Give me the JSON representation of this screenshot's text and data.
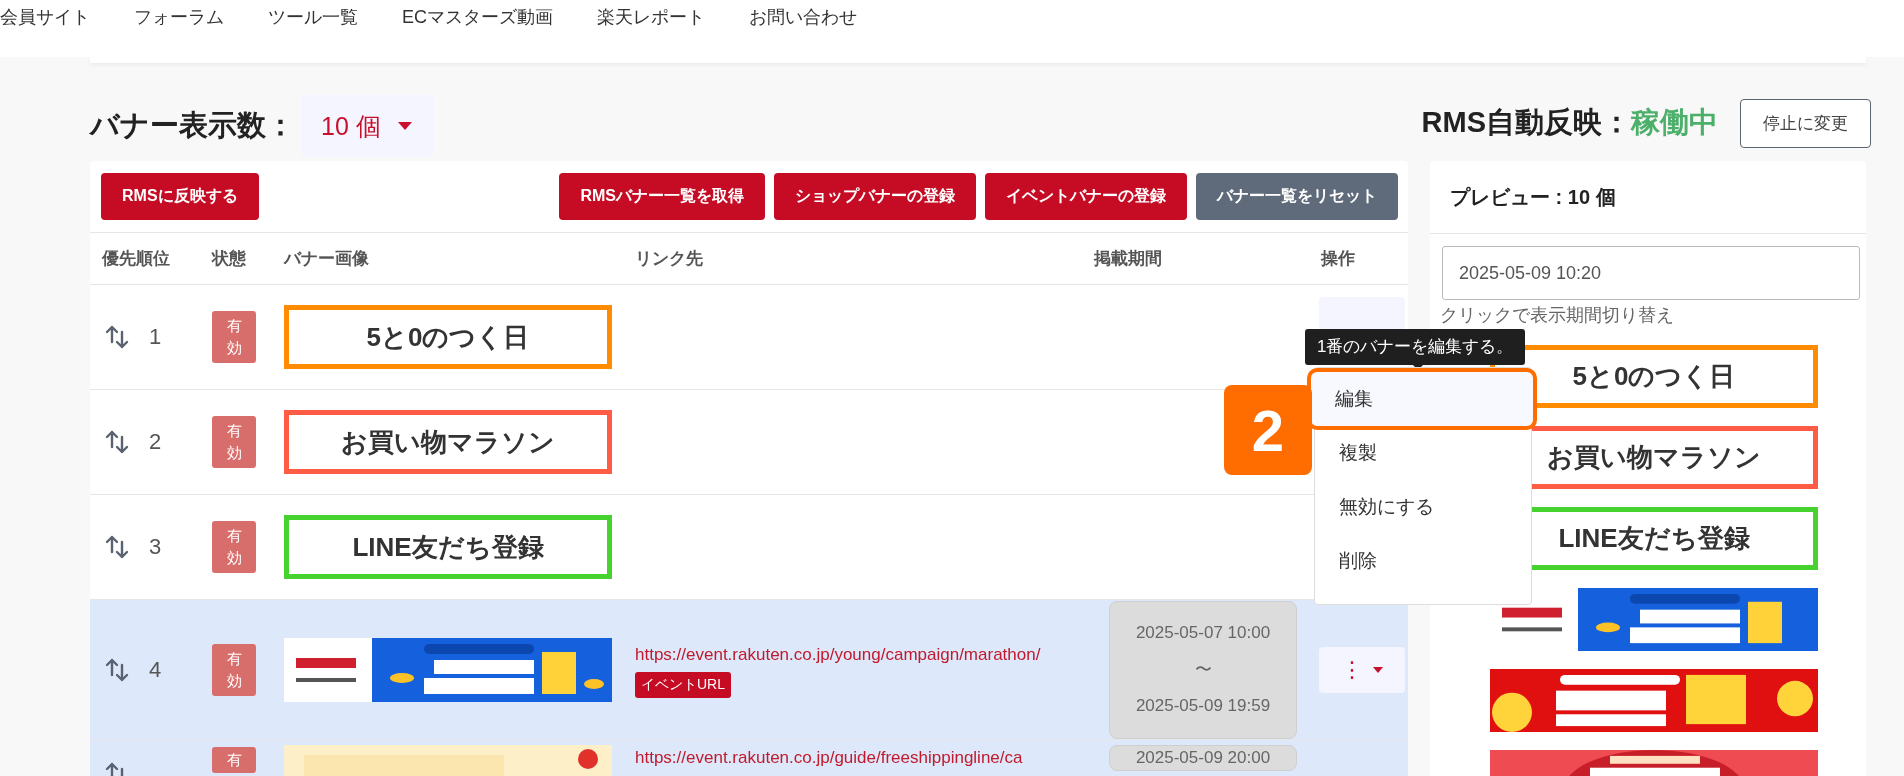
{
  "nav": {
    "items": [
      "会員サイト",
      "フォーラム",
      "ツール一覧",
      "ECマスターズ動画",
      "楽天レポート",
      "お問い合わせ"
    ]
  },
  "banner_count": {
    "label": "バナー表示数：",
    "value": "10 個"
  },
  "auto_sync": {
    "label": "RMS自動反映：",
    "status": "稼働中",
    "button": "停止に変更"
  },
  "toolbar": {
    "left": [
      "RMSに反映する"
    ],
    "right": [
      {
        "label": "RMSバナー一覧を取得",
        "kind": "primary"
      },
      {
        "label": "ショップバナーの登録",
        "kind": "primary"
      },
      {
        "label": "イベントバナーの登録",
        "kind": "primary"
      },
      {
        "label": "バナー一覧をリセット",
        "kind": "secondary"
      }
    ]
  },
  "table": {
    "columns": [
      "優先順位",
      "状態",
      "バナー画像",
      "リンク先",
      "掲載期間",
      "操作"
    ],
    "rows": [
      {
        "priority": "1",
        "state": "有効",
        "banner": {
          "kind": "text",
          "label": "5と0のつく日",
          "color": "#ff8c00"
        },
        "highlighted": false,
        "menu_open": true
      },
      {
        "priority": "2",
        "state": "有効",
        "banner": {
          "kind": "text",
          "label": "お買い物マラソン",
          "color": "#ff5c45"
        },
        "highlighted": false,
        "menu_open": false
      },
      {
        "priority": "3",
        "state": "有効",
        "banner": {
          "kind": "text",
          "label": "LINE友だち登録",
          "color": "#46d330"
        },
        "highlighted": false,
        "menu_open": false
      },
      {
        "priority": "4",
        "state": "有効",
        "banner": {
          "kind": "picture"
        },
        "link": "https://event.rakuten.co.jp/young/campaign/marathon/",
        "tag": "イベントURL",
        "period": [
          "2025-05-07 10:00",
          "〜",
          "2025-05-09 19:59"
        ],
        "actions": "⋮",
        "highlighted": true,
        "menu_open": false
      },
      {
        "priority": "",
        "state": "有",
        "banner": {
          "kind": "picture"
        },
        "link": "https://event.rakuten.co.jp/guide/freeshippingline/ca",
        "period": [
          "2025-05-09 20:00"
        ],
        "highlighted": true,
        "menu_open": false
      }
    ]
  },
  "tooltip": "1番のバナーを編集する。",
  "menu": [
    {
      "label": "編集",
      "selected": true
    },
    {
      "label": "複製",
      "selected": false
    },
    {
      "label": "無効にする",
      "selected": false
    },
    {
      "label": "削除",
      "selected": false
    }
  ],
  "step_badge": "2",
  "preview": {
    "title": "プレビュー : 10 個",
    "datetime": "2025-05-09 10:20",
    "hint": "クリックで表示期間切り替え",
    "banners": [
      {
        "kind": "text",
        "label": "5と0のつく日",
        "color": "#ff8c00"
      },
      {
        "kind": "text",
        "label": "お買い物マラソン",
        "color": "#ff5c45"
      },
      {
        "kind": "text",
        "label": "LINE友だち登録",
        "color": "#46d330"
      },
      {
        "kind": "picture"
      },
      {
        "kind": "picture"
      },
      {
        "kind": "picture"
      }
    ]
  }
}
